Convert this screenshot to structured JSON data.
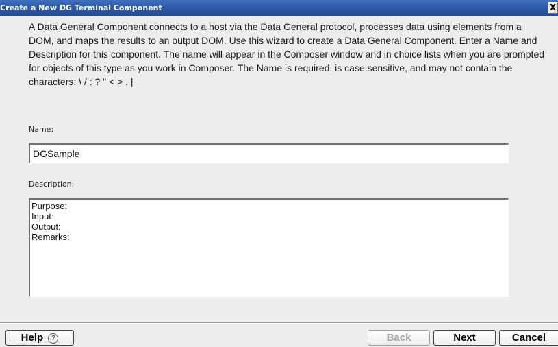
{
  "window": {
    "title": "Create a New DG Terminal Component",
    "close_label": "X"
  },
  "intro": {
    "text": "A Data General Component connects to a host via the Data General protocol, processes data using elements from a DOM, and maps the results to an output DOM.  Use this wizard to create a Data General Component.  Enter a Name and Description for this component.  The name will appear in the Composer window and in choice lists when you are prompted for objects of this type as you work in Composer.  The Name is required, is case sensitive, and may not contain the characters: \\ / : ? \" < > . |"
  },
  "name_field": {
    "label": "Name:",
    "value": "DGSample"
  },
  "description_field": {
    "label": "Description:",
    "lines": [
      "Purpose:",
      "Input:",
      "Output:",
      "Remarks:"
    ]
  },
  "buttons": {
    "help": "Help",
    "help_icon": "?",
    "back": "Back",
    "next": "Next",
    "cancel": "Cancel"
  },
  "icons": {
    "help": "help-circle-icon",
    "close": "close-icon"
  },
  "colors": {
    "titlebar": "#2b58a6",
    "dialog_bg": "#ededed",
    "disabled_text": "#a8a8a8"
  }
}
